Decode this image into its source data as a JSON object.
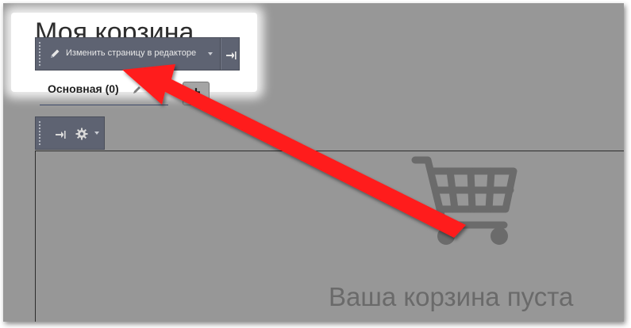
{
  "page": {
    "title": "Моя корзина"
  },
  "editor_toolbar": {
    "edit_label": "Изменить страницу в редакторе"
  },
  "tabs": [
    {
      "label": "Основная (0)"
    }
  ],
  "add_tab": {
    "label": "+"
  },
  "cart": {
    "empty_message": "Ваша корзина пуста"
  },
  "colors": {
    "overlay": "#979797",
    "toolbar": "#5e6372",
    "arrow": "#ff1a1a"
  },
  "icons": [
    "pencil-icon",
    "pin-icon",
    "gear-icon",
    "cart-icon",
    "chevron-down-icon",
    "plus-icon"
  ]
}
